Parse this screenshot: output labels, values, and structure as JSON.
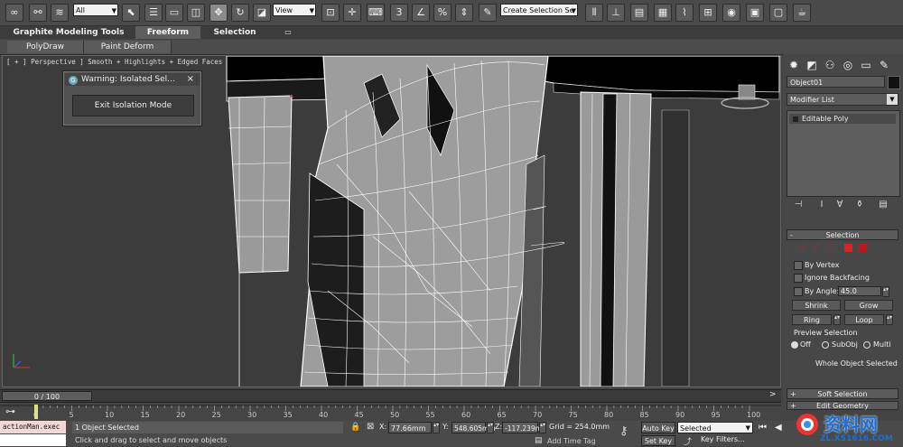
{
  "toolbar": {
    "selection_filter": "All",
    "ref_coord": "View",
    "named_selection": "Create Selection Se"
  },
  "ribbon": {
    "tabs": [
      "Graphite Modeling Tools",
      "Freeform",
      "Selection"
    ],
    "active_tab": "Freeform",
    "subtabs": [
      "PolyDraw",
      "Paint Deform"
    ]
  },
  "viewport": {
    "label": "[ + ] Perspective ] Smooth + Highlights + Edged Faces ]"
  },
  "isolation_dialog": {
    "title": "Warning: Isolated Sel...",
    "close_glyph": "×",
    "button": "Exit Isolation Mode"
  },
  "command_panel": {
    "object_name": "Object01",
    "modifier_list": "Modifier List",
    "stack_item": "Editable Poly",
    "selection_rollout": {
      "title": "Selection",
      "by_vertex": "By Vertex",
      "ignore_backfacing": "Ignore Backfacing",
      "by_angle": "By Angle:",
      "angle_value": "45.0",
      "shrink": "Shrink",
      "grow": "Grow",
      "ring": "Ring",
      "loop": "Loop",
      "preview_label": "Preview Selection",
      "preview_options": [
        "Off",
        "SubObj",
        "Multi"
      ],
      "status": "Whole Object Selected"
    },
    "soft_selection_title": "Soft Selection",
    "edit_geometry_title": "Edit Geometry"
  },
  "timeline": {
    "frame_display": "0 / 100",
    "ticks": [
      "0",
      "5",
      "10",
      "15",
      "20",
      "25",
      "30",
      "35",
      "40",
      "45",
      "50",
      "55",
      "60",
      "65",
      "70",
      "75",
      "80",
      "85",
      "90",
      "95",
      "100"
    ]
  },
  "statusbar": {
    "maxscript": "actionMan.exec",
    "selection_count": "1 Object Selected",
    "prompt": "Click and drag to select and move objects",
    "x_label": "X:",
    "x_value": "77.66mm",
    "y_label": "Y:",
    "y_value": "548.605mm",
    "z_label": "Z:",
    "z_value": "-117.239m",
    "grid": "Grid = 254.0mm",
    "auto_key": "Auto Key",
    "set_key": "Set Key",
    "key_mode": "Selected",
    "key_filters": "Key Filters...",
    "add_time_tag": "Add Time Tag"
  },
  "watermark": {
    "title": "资料网",
    "url": "ZL.XS1616.COM"
  },
  "colors": {
    "viewport_bg": "#3c3c3c",
    "wireframe": "#ffffff",
    "ui_dark": "#474747",
    "selection_red": "#e02020"
  }
}
